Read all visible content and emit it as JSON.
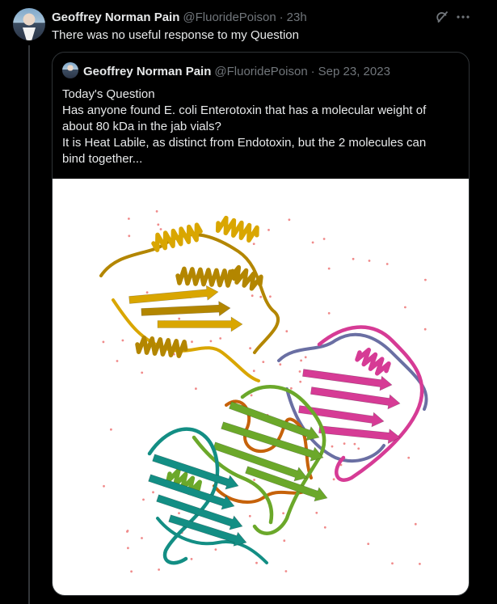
{
  "post": {
    "author_name": "Geoffrey Norman Pain",
    "author_handle": "@FluoridePoison",
    "separator": "·",
    "time": "23h",
    "text": "There was no useful response to my Question"
  },
  "quoted_post": {
    "author_name": "Geoffrey Norman Pain",
    "author_handle": "@FluoridePoison",
    "separator": "·",
    "date": "Sep 23, 2023",
    "lines": [
      "Today's Question",
      "Has anyone found E. coli Enterotoxin that has a molecular weight of",
      "about 80 kDa in the jab vials?",
      "It is Heat Labile, as distinct from Endotoxin, but the 2 molecules can",
      "bind together..."
    ]
  },
  "media": {
    "subject": "protein ribbon structure",
    "colors": {
      "gold": "#d9a600",
      "gold_dark": "#b38600",
      "magenta": "#d63b95",
      "slate": "#6a6fa3",
      "green": "#6ba82a",
      "teal": "#138e84",
      "orange": "#c6620a",
      "dots": "#f08a8a"
    }
  },
  "icons": {
    "grok": "grok-icon",
    "more": "more-icon"
  }
}
